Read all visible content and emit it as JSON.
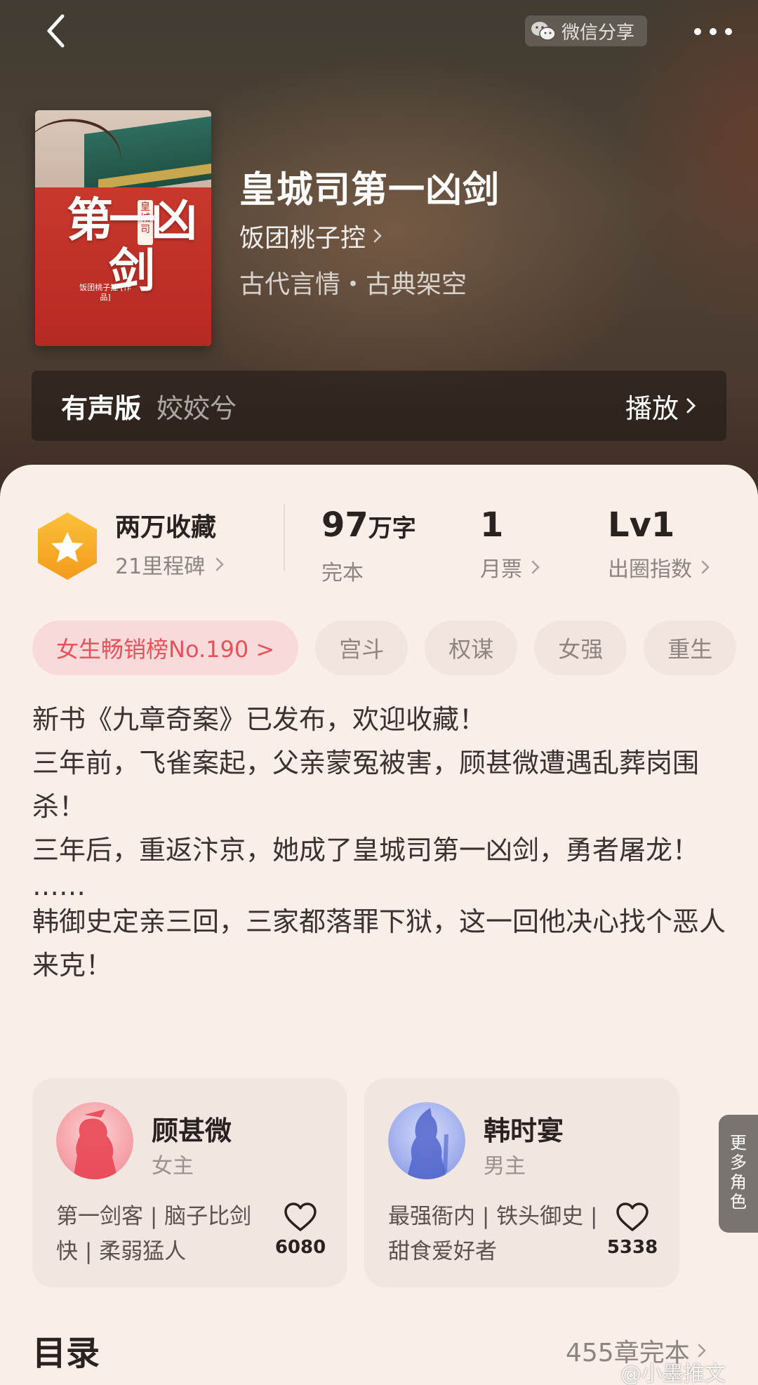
{
  "header": {
    "share_label": "微信分享"
  },
  "book": {
    "title": "皇城司第一凶剑",
    "author": "饭团桃子控",
    "genres": "古代言情・古典架空",
    "cover_title": "第一凶剑",
    "cover_subtitle": "皇城司",
    "cover_author": "饭团桃子控 [作品]"
  },
  "audio": {
    "label": "有声版",
    "narrator": "姣姣兮",
    "play_label": "播放"
  },
  "stats": {
    "collect_title": "两万收藏",
    "collect_sub": "21里程碑",
    "words_value": "97",
    "words_unit": "万字",
    "words_status": "完本",
    "ticket_value": "1",
    "ticket_label": "月票",
    "level_value": "Lv1",
    "level_label": "出圈指数"
  },
  "tags": {
    "hot": "女生畅销榜No.190 >",
    "items": [
      "宫斗",
      "权谋",
      "女强",
      "重生"
    ]
  },
  "description": {
    "line1": "新书《九章奇案》已发布，欢迎收藏！",
    "line2": "三年前，飞雀案起，父亲蒙冤被害，顾甚微遭遇乱葬岗围杀！",
    "line3": "三年后，重返汴京，她成了皇城司第一凶剑，勇者屠龙！",
    "line4": "……",
    "line5": "韩御史定亲三回，三家都落罪下狱，这一回他决心找个恶人来克！"
  },
  "characters": [
    {
      "name": "顾甚微",
      "role": "女主",
      "traits": "第一剑客 | 脑子比剑快 | 柔弱猛人",
      "likes": "6080"
    },
    {
      "name": "韩时宴",
      "role": "男主",
      "traits": "最强衙内 | 铁头御史 | 甜食爱好者",
      "likes": "5338"
    }
  ],
  "more_roles_label": "更多角色",
  "toc": {
    "title": "目录",
    "info": "455章完本"
  },
  "watermark": "@小墨推文",
  "colors": {
    "badge": "#f7a823",
    "hot_tag_text": "#e8505a",
    "hot_tag_bg": "#f8dada",
    "page_bg": "#f9efe8"
  }
}
